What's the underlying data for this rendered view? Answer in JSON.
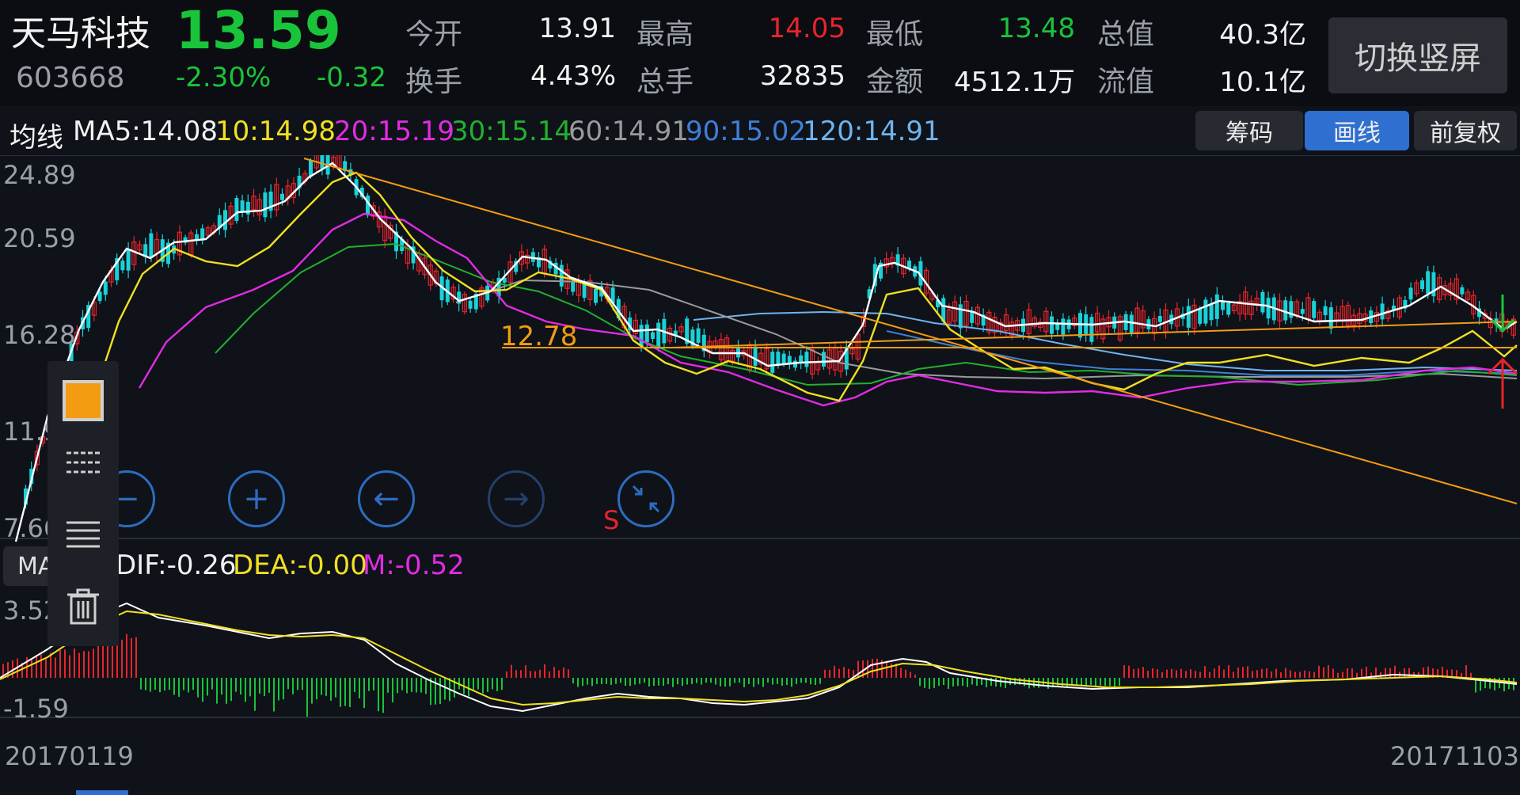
{
  "header": {
    "name": "天马科技",
    "code": "603668",
    "price": "13.59",
    "change_pct": "-2.30%",
    "change": "-0.32",
    "quotes": [
      {
        "label": "今开",
        "value": "13.91",
        "color": "white"
      },
      {
        "label": "最高",
        "value": "14.05",
        "color": "red"
      },
      {
        "label": "最低",
        "value": "13.48",
        "color": "green"
      },
      {
        "label": "总值",
        "value": "40.3亿",
        "color": "white"
      },
      {
        "label": "换手",
        "value": "4.43%",
        "color": "white"
      },
      {
        "label": "总手",
        "value": "32835",
        "color": "white"
      },
      {
        "label": "金额",
        "value": "4512.1万",
        "color": "white"
      },
      {
        "label": "流值",
        "value": "10.1亿",
        "color": "white"
      }
    ],
    "switch_label": "切换竖屏"
  },
  "ma_bar": {
    "title": "均线",
    "items": [
      {
        "text": "MA5:14.08",
        "color": "#f2f2f2"
      },
      {
        "text": "10:14.98",
        "color": "#f0e020"
      },
      {
        "text": "20:15.19",
        "color": "#e22be2"
      },
      {
        "text": "30:15.14",
        "color": "#22b02e"
      },
      {
        "text": "60:14.91",
        "color": "#9a9a9a"
      },
      {
        "text": "90:15.02",
        "color": "#3f7fd8"
      },
      {
        "text": "120:14.91",
        "color": "#6fb4ee"
      }
    ],
    "buttons": {
      "chips": "筹码",
      "draw": "画线",
      "adjust": "前复权"
    }
  },
  "kline": {
    "y_labels": [
      "24.89",
      "20.59",
      "16.28",
      "11.9",
      "7.66"
    ],
    "support_label": "12.78",
    "signal_s": "S"
  },
  "macd": {
    "tag": "MACD",
    "dif": "DIF:-0.26",
    "dea": "DEA:-0.00",
    "m": "M:-0.52",
    "y_top": "3.52",
    "y_bottom": "-1.59"
  },
  "dates": {
    "start": "20170119",
    "end": "20171103"
  },
  "icons": [
    "color-swatch-icon",
    "dashed-lines-icon",
    "solid-lines-icon",
    "trash-icon",
    "zoom-out-icon",
    "zoom-in-icon",
    "pan-left-icon",
    "pan-right-icon",
    "collapse-icon"
  ],
  "colors": {
    "up": "#e8242b",
    "down": "#19d2d8",
    "green": "#19c43a",
    "accent": "#2f6fd0",
    "trendline": "#f39c12"
  }
}
